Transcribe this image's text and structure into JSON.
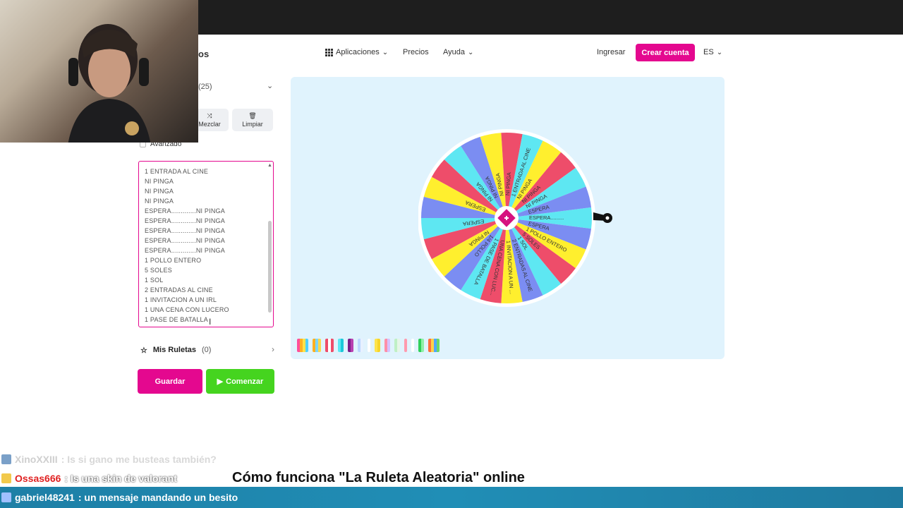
{
  "nav": {
    "logo_fragment": "os",
    "apps": "Aplicaciones",
    "pricing": "Precios",
    "help": "Ayuda",
    "login": "Ingresar",
    "signup": "Crear cuenta",
    "lang": "ES"
  },
  "sidebar": {
    "header": "(25)",
    "shuffle": "Mezclar",
    "clear": "Limpiar",
    "advanced": "Avanzado",
    "entries": [
      "1 ENTRADA AL CINE",
      "NI PINGA",
      "NI PINGA",
      "NI PINGA",
      "ESPERA.............NI PINGA",
      "ESPERA.............NI PINGA",
      "ESPERA.............NI PINGA",
      "ESPERA.............NI PINGA",
      "ESPERA.............NI PINGA",
      "1 POLLO ENTERO",
      "5 SOLES",
      "1 SOL",
      "2 ENTRADAS AL CINE",
      "1 INVITACION A UN IRL",
      "1 UNA CENA CON LUCERO",
      "1 PASE DE BATALLA"
    ],
    "my_wheels": "Mis Ruletas",
    "my_wheels_count": "(0)",
    "save": "Guardar",
    "start": "Comenzar"
  },
  "wheel": {
    "segments": [
      {
        "label": "ESPERA.........",
        "color": "#5ee7f2"
      },
      {
        "label": "ESPERA",
        "color": "#7b8df2"
      },
      {
        "label": "1 POLLO ENTERO",
        "color": "#ffef2e"
      },
      {
        "label": "5 SOLES",
        "color": "#ee4d6a"
      },
      {
        "label": "1 SOL",
        "color": "#5ee7f2"
      },
      {
        "label": "2 ENTRADAS AL CINE",
        "color": "#7b8df2"
      },
      {
        "label": "1 INVITACION A UN ...",
        "color": "#ffef2e"
      },
      {
        "label": "UNA CENA CON LUC...",
        "color": "#ee4d6a"
      },
      {
        "label": "1 PASE DE BATALLA",
        "color": "#5ee7f2"
      },
      {
        "label": "1/4 POLLO",
        "color": "#7b8df2"
      },
      {
        "label": "NI PINGA",
        "color": "#ffef2e"
      },
      {
        "label": "",
        "color": "#ee4d6a"
      },
      {
        "label": "ESPERA",
        "color": "#5ee7f2"
      },
      {
        "label": "",
        "color": "#7b8df2"
      },
      {
        "label": "ESPERA",
        "color": "#ffef2e"
      },
      {
        "label": "",
        "color": "#ee4d6a"
      },
      {
        "label": "NI PINGA",
        "color": "#5ee7f2"
      },
      {
        "label": "NI PINGA",
        "color": "#7b8df2"
      },
      {
        "label": "NI PINGA",
        "color": "#ffef2e"
      },
      {
        "label": "NI PINGA",
        "color": "#ee4d6a"
      },
      {
        "label": "1 ENTRADA AL CINE",
        "color": "#5ee7f2"
      },
      {
        "label": "NI PINGA",
        "color": "#ffef2e"
      },
      {
        "label": "NI PINGA",
        "color": "#ee4d6a"
      },
      {
        "label": "NI PINGA",
        "color": "#5ee7f2"
      },
      {
        "label": "ESPERA",
        "color": "#7b8df2"
      }
    ]
  },
  "palettes": [
    [
      "#ff4f9a",
      "#ffb020",
      "#ffe34a",
      "#4fd1ff"
    ],
    [
      "#ffb020",
      "#7ad6ff",
      "#ffd84a"
    ],
    [
      "#ee4d6a",
      "#ffffff",
      "#ee4d6a"
    ],
    [
      "#5ee7f2",
      "#1cc9d9"
    ],
    [
      "#7a1f8a",
      "#b83fb0"
    ],
    [
      "#bcd6ff",
      "#e7f1ff"
    ],
    [
      "#ffffff"
    ],
    [
      "#ffe34a",
      "#f6d52a"
    ],
    [
      "#ff8fa8",
      "#d6c2ff"
    ],
    [
      "#bff0c5",
      "#e6f6e7"
    ],
    [
      "#ff9aae"
    ],
    [
      "#ffffff"
    ],
    [
      "#2fd05a",
      "#8ff0a8"
    ],
    [
      "#ff6f3c",
      "#ffd14a",
      "#4fa8ff",
      "#6ad86a"
    ]
  ],
  "footer": {
    "title": "Cómo funciona \"La Ruleta Aleatoria\" online"
  },
  "chat": [
    {
      "user": "XinoXXIII",
      "msg": ": Is si gano me busteas también?",
      "color": "#cfcfcf",
      "badge": "#7aa0c8"
    },
    {
      "user": "Ossas666",
      "msg": ": Is una skin de valorant",
      "color": "#e02020",
      "badge": "#f2c94c"
    },
    {
      "user": "gabriel48241",
      "msg": ": un mensaje mandando un besito",
      "color": "#ffffff",
      "badge": "#a0c0ff"
    }
  ]
}
